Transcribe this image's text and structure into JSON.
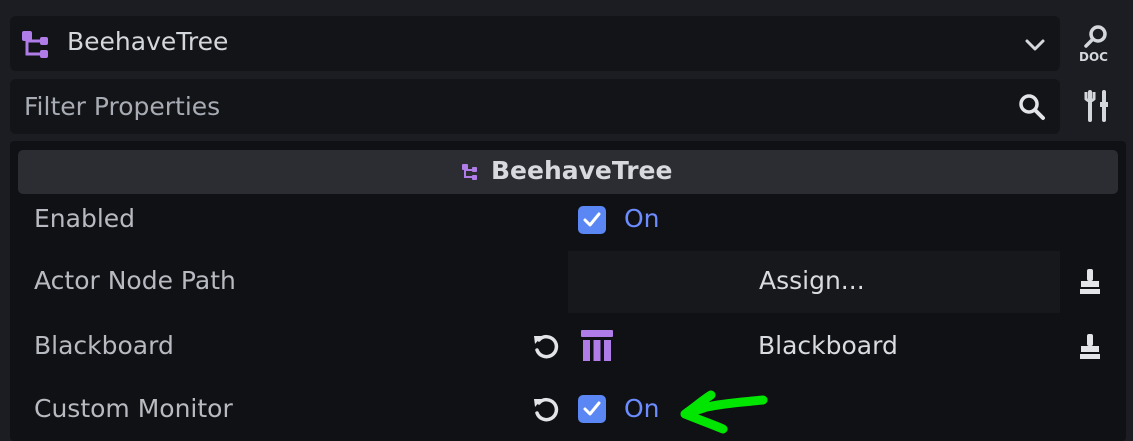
{
  "header": {
    "node_name": "BeehaveTree",
    "node_icon": "beehave-tree-icon",
    "dropdown_icon": "chevron-down-icon",
    "doc_button_icon": "doc-search-icon"
  },
  "filter": {
    "placeholder": "Filter Properties",
    "search_icon": "search-icon",
    "tools_icon": "tools-icon"
  },
  "section": {
    "title": "BeehaveTree",
    "icon": "beehave-tree-icon"
  },
  "properties": {
    "enabled": {
      "label": "Enabled",
      "checked": true,
      "value_text": "On"
    },
    "actor_node_path": {
      "label": "Actor Node Path",
      "button": "Assign..."
    },
    "blackboard": {
      "label": "Blackboard",
      "value": "Blackboard"
    },
    "custom_monitor": {
      "label": "Custom Monitor",
      "checked": true,
      "value_text": "On"
    }
  },
  "colors": {
    "accent": "#5a87f3",
    "on_text": "#6c8cff",
    "beehave_icon": "#b07ce8",
    "annotation_arrow": "#00e600"
  }
}
